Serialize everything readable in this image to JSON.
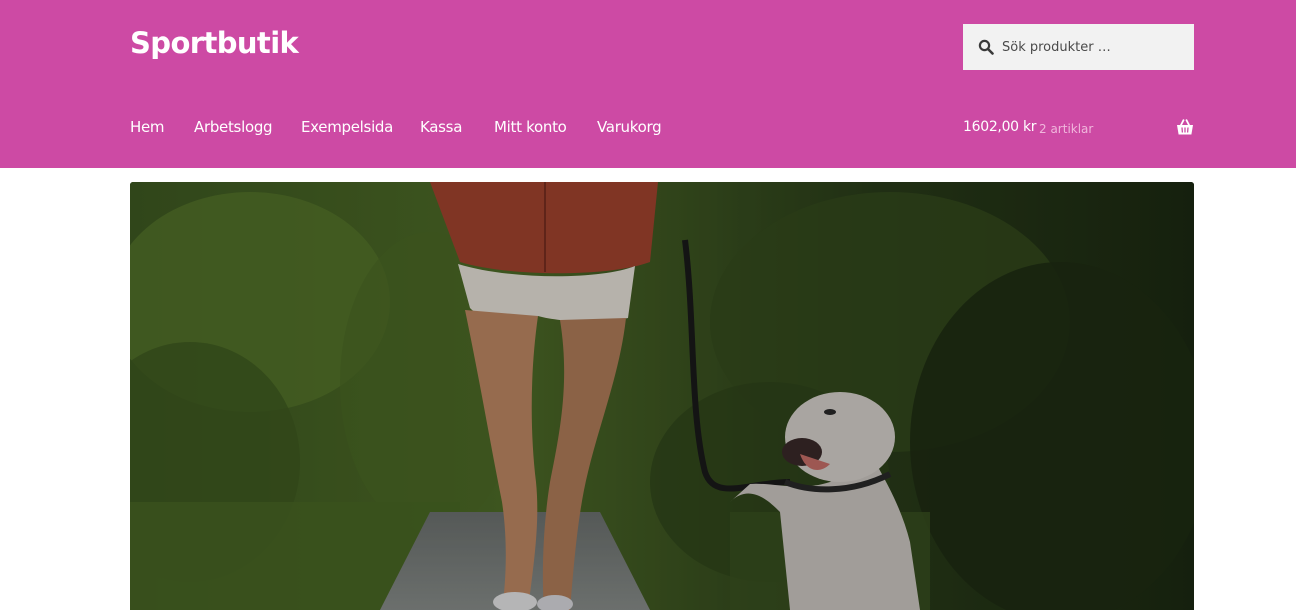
{
  "site": {
    "title": "Sportbutik"
  },
  "search": {
    "placeholder": "Sök produkter …",
    "icon": "search-icon"
  },
  "nav": {
    "items": [
      {
        "label": "Hem"
      },
      {
        "label": "Arbetslogg"
      },
      {
        "label": "Exempelsida"
      },
      {
        "label": "Kassa"
      },
      {
        "label": "Mitt konto"
      },
      {
        "label": "Varukorg"
      }
    ]
  },
  "cart": {
    "amount": "1602,00 kr",
    "count": "2 artiklar",
    "icon": "basket-icon"
  },
  "colors": {
    "header_bg": "#cd4aa4",
    "search_bg": "#f2f2f2",
    "text_on_header": "#ffffff"
  }
}
